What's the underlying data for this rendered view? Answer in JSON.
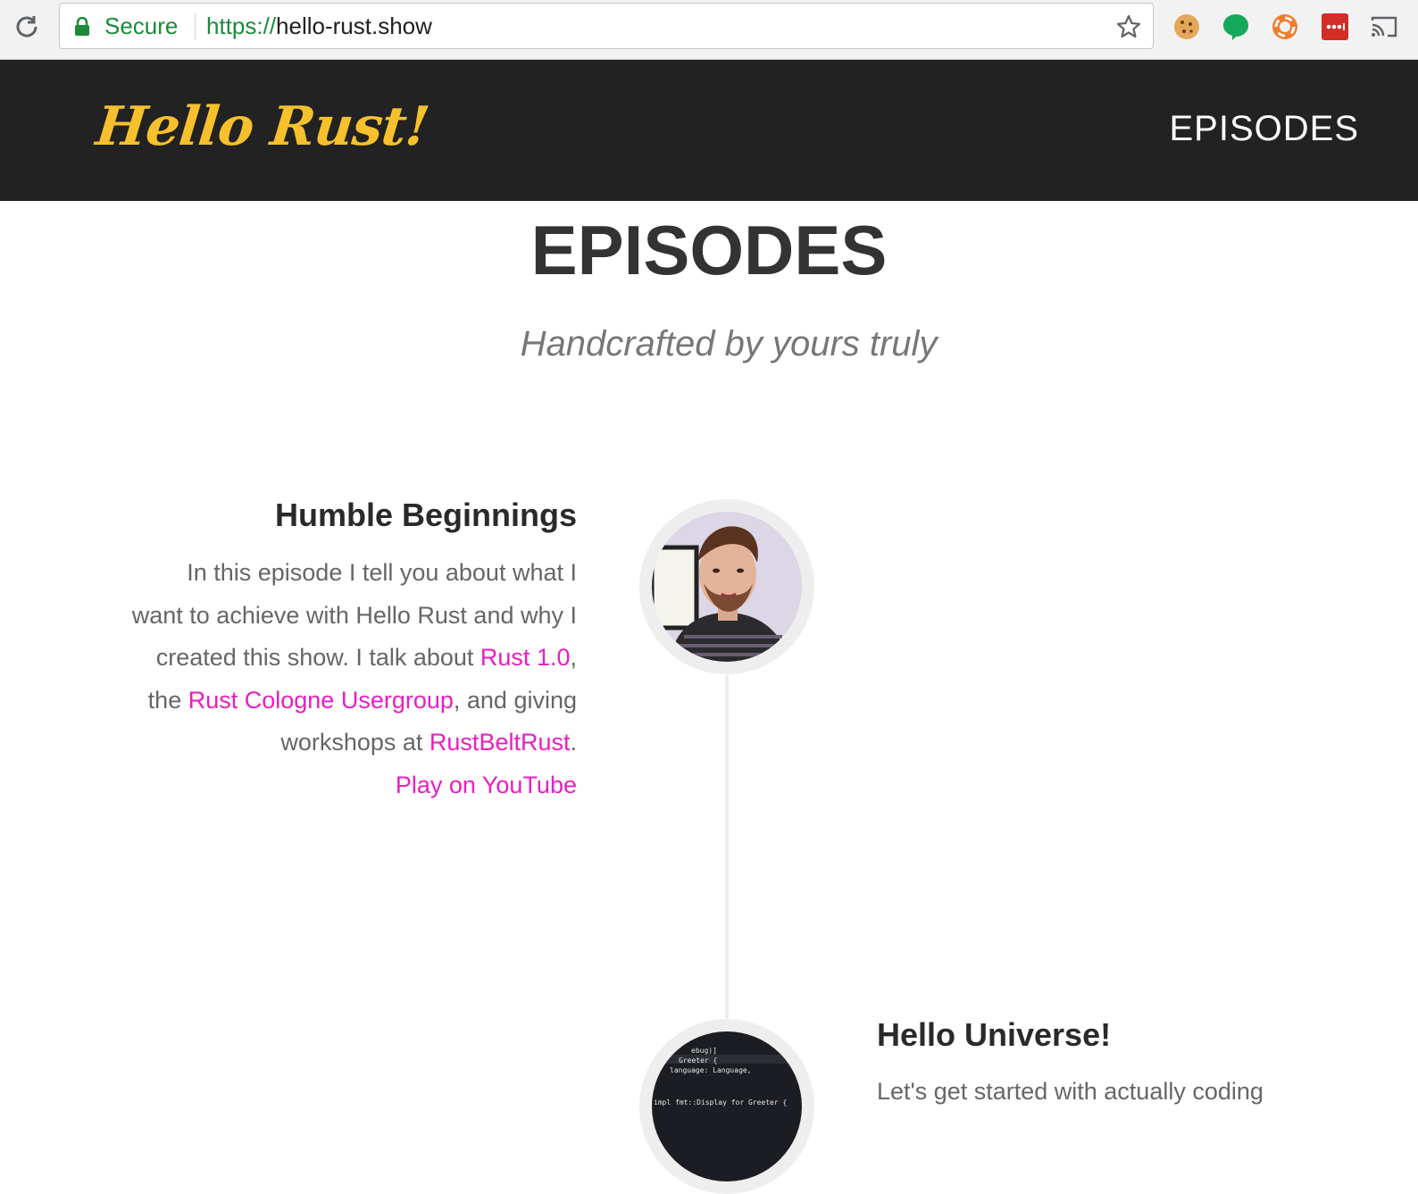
{
  "browser": {
    "secure_label": "Secure",
    "url_scheme": "https://",
    "url_host": "hello-rust.show",
    "icons": [
      "reload-icon",
      "lock-icon",
      "star-icon",
      "cookie-extension-icon",
      "chat-extension-icon",
      "lifebuoy-extension-icon",
      "password-extension-icon",
      "cast-icon"
    ]
  },
  "header": {
    "logo": "Hello Rust!",
    "nav_episodes": "EPISODES",
    "logo_color": "#f6c12d",
    "background": "#222222"
  },
  "main": {
    "title": "EPISODES",
    "subtitle": "Handcrafted by yours truly"
  },
  "episodes": [
    {
      "title": "Humble Beginnings",
      "desc_1": "In this episode I tell you about what I want to achieve with Hello Rust and why I created this show. I talk about ",
      "link_rust": "Rust 1.0",
      "desc_2": ", the ",
      "link_usergroup": "Rust Cologne Usergroup",
      "desc_3": ", and giving workshops at ",
      "link_rustbelt": "RustBeltRust",
      "desc_4": ".",
      "play": "Play on YouTube"
    },
    {
      "title": "Hello Universe!",
      "desc": "Let's get started with actually coding",
      "code_lines": [
        "ebug)]",
        "Greeter {",
        "language: Language,",
        "impl fmt::Display for Greeter {"
      ]
    }
  ],
  "colors": {
    "link": "#e91ec0",
    "secure": "#1b8a3a"
  }
}
